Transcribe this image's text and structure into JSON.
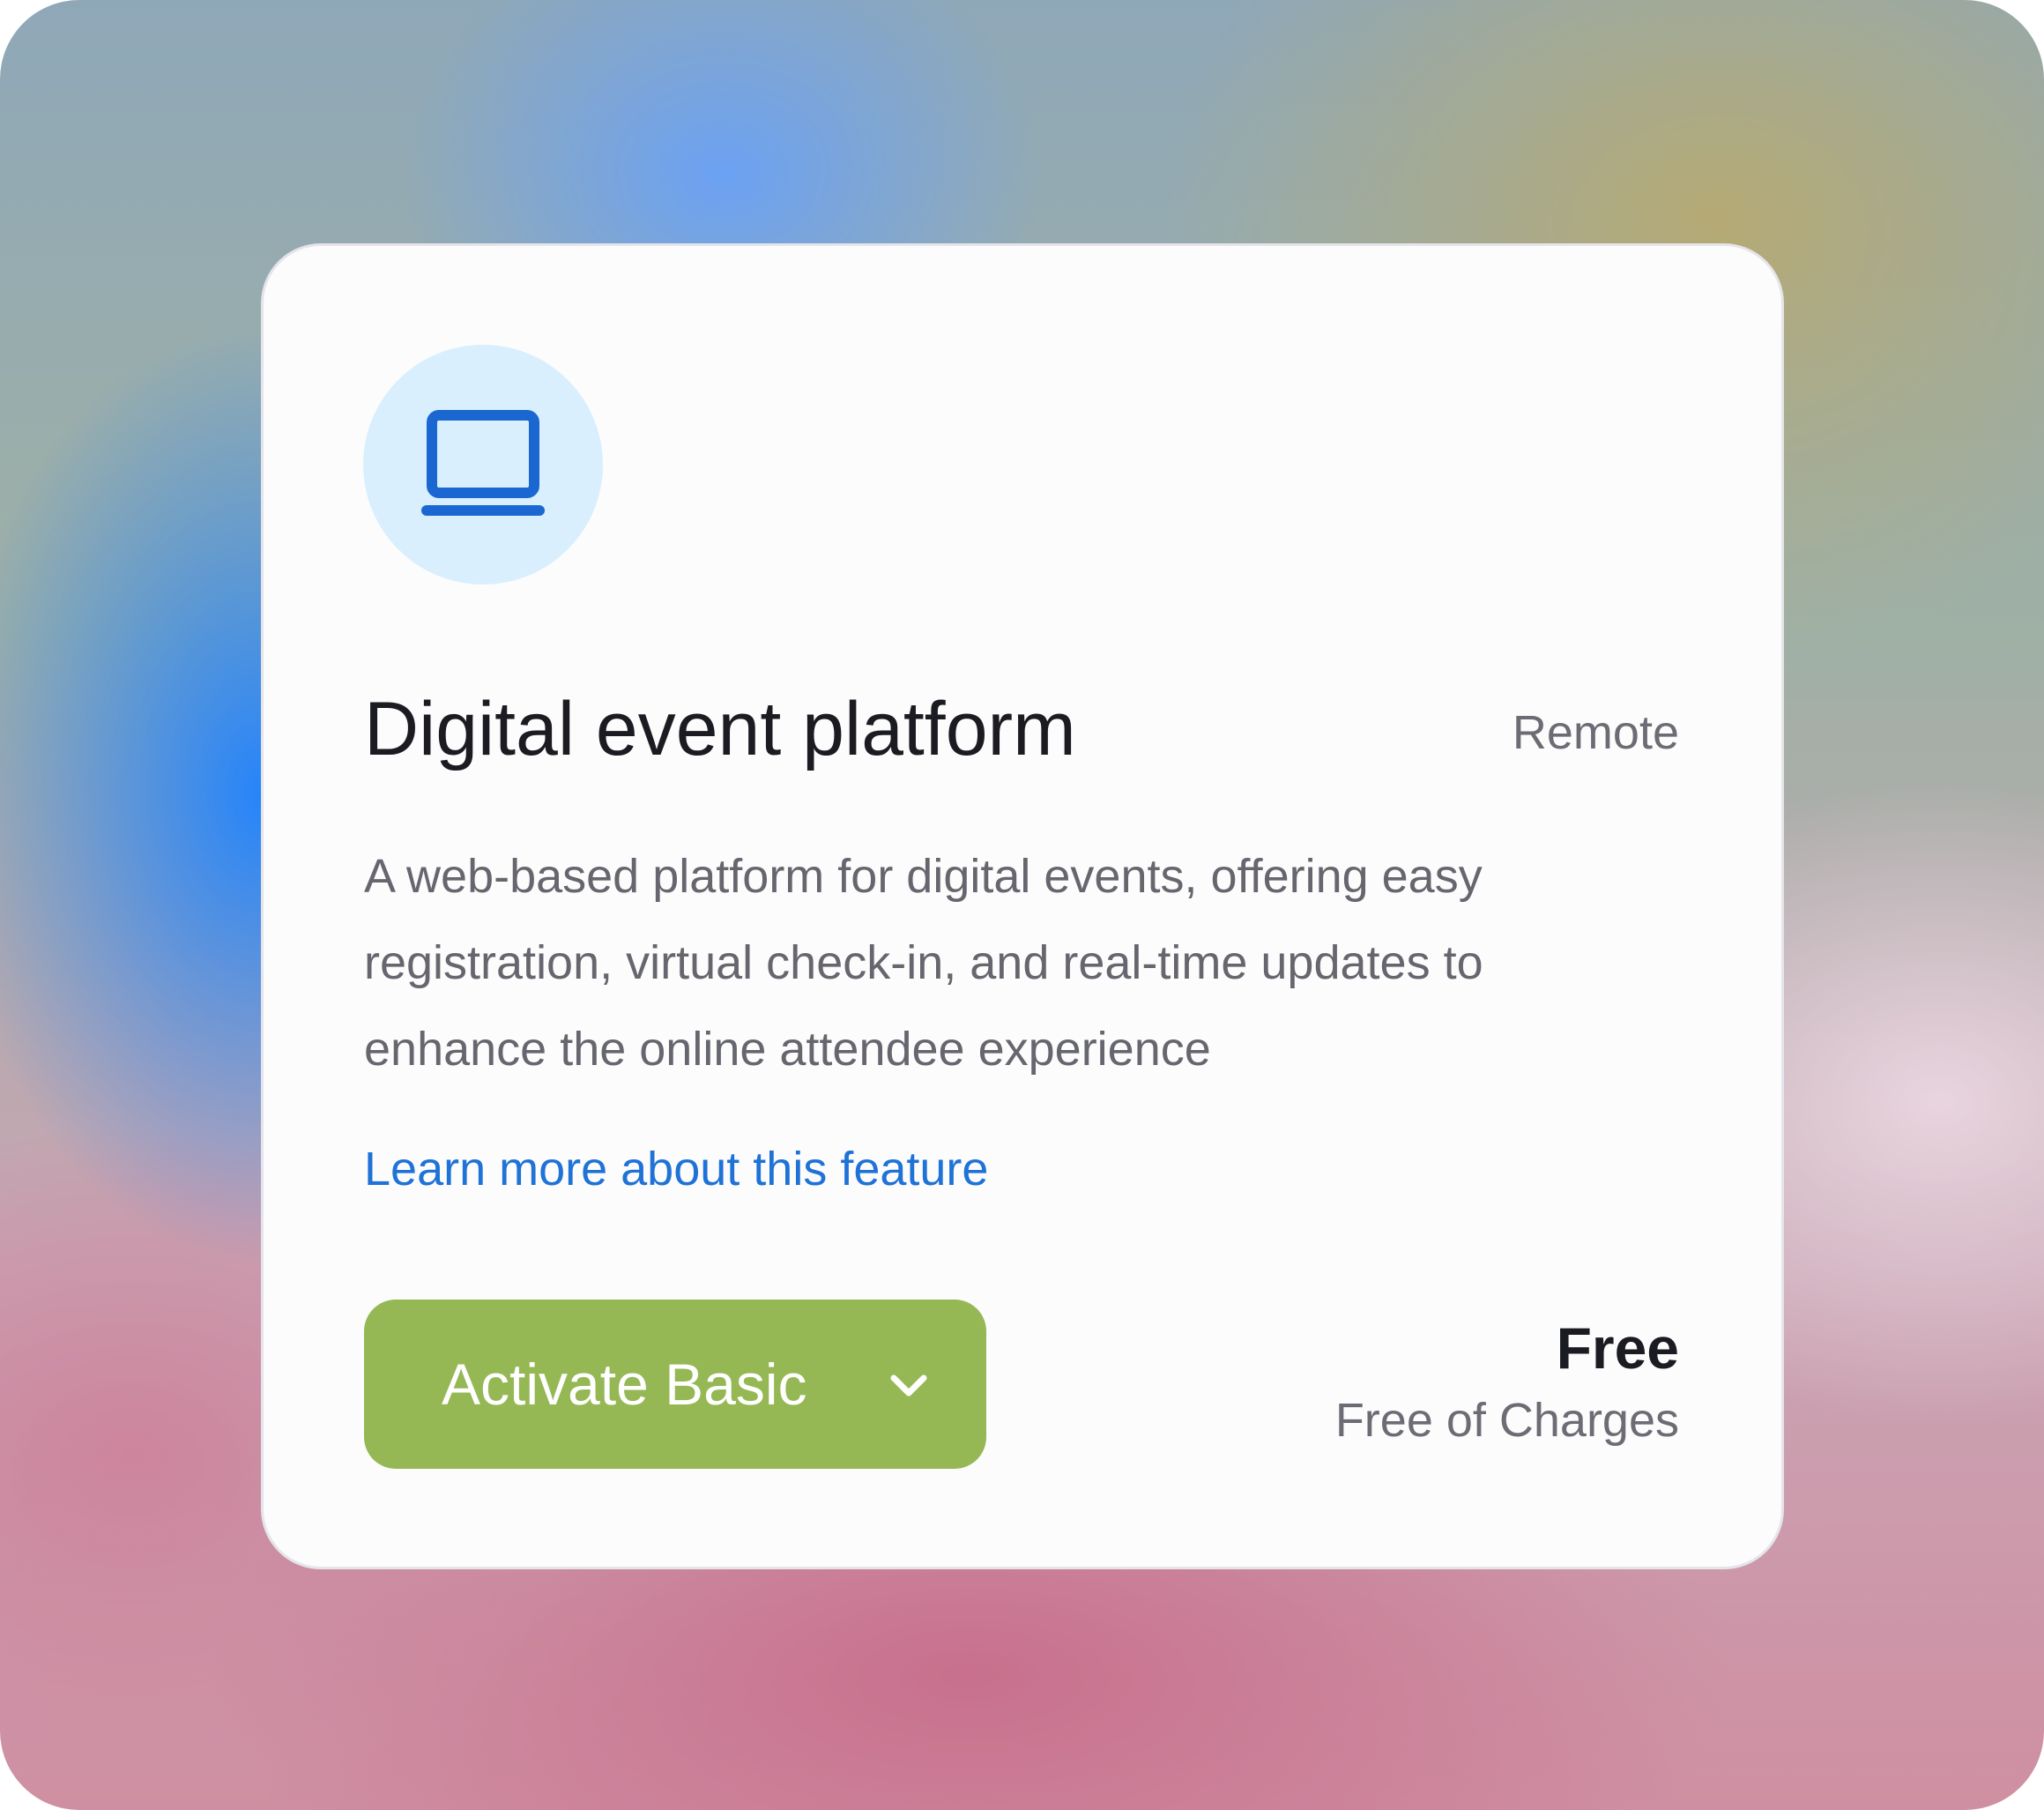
{
  "feature": {
    "icon": "laptop-icon",
    "title": "Digital event platform",
    "tag": "Remote",
    "description": "A web-based platform for digital events, offering easy registration, virtual check-in, and real-time updates to enhance the online attendee experience",
    "learn_more_label": "Learn more about this feature"
  },
  "action": {
    "button_label": "Activate Basic",
    "dropdown_icon": "chevron-down-icon"
  },
  "pricing": {
    "price": "Free",
    "note": "Free of Charges"
  },
  "colors": {
    "button_green": "#95b855",
    "link_blue": "#1f72d6",
    "icon_blue": "#1a67d2",
    "icon_circle": "#d9effd",
    "card_bg": "#fcfcfd"
  }
}
